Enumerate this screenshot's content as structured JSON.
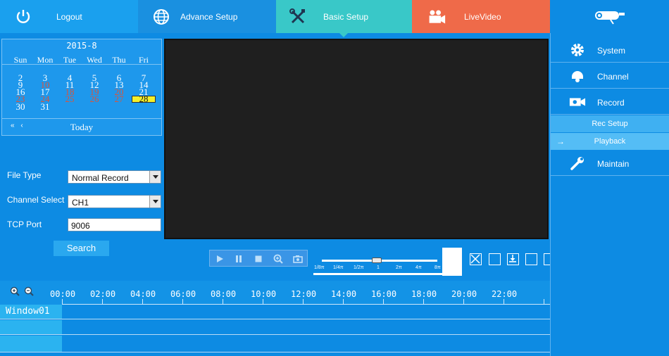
{
  "top_tabs": {
    "logout": "Logout",
    "advance": "Advance Setup",
    "basic": "Basic Setup",
    "live": "LiveVideo"
  },
  "calendar": {
    "title": "2015-8",
    "weekdays": [
      "Sun",
      "Mon",
      "Tue",
      "Wed",
      "Thu",
      "Fri"
    ],
    "days": {
      "d2": "2",
      "d3": "3",
      "d4": "4",
      "d5": "5",
      "d6": "6",
      "d7": "7",
      "d9": "9",
      "d10": "10",
      "d11": "11",
      "d12": "12",
      "d13": "13",
      "d14": "14",
      "d16": "16",
      "d17": "17",
      "d18": "18",
      "d19": "19",
      "d20": "20",
      "d21": "21",
      "d23": "23",
      "d24": "24",
      "d25": "25",
      "d26": "26",
      "d27": "27",
      "d28": "28",
      "d30": "30",
      "d31": "31"
    },
    "nav": "« ‹",
    "today": "Today"
  },
  "form": {
    "file_type_label": "File Type",
    "file_type_value": "Normal Record",
    "channel_label": "Channel Select",
    "channel_value": "CH1",
    "tcp_label": "TCP Port",
    "tcp_value": "9006",
    "search": "Search"
  },
  "speed": {
    "labels": [
      "1/8π",
      "1/4π",
      "1/2π",
      "1",
      "2π",
      "4π",
      "8π"
    ],
    "current": "1"
  },
  "timeline": {
    "hours": [
      "00:00",
      "02:00",
      "04:00",
      "06:00",
      "08:00",
      "10:00",
      "12:00",
      "14:00",
      "16:00",
      "18:00",
      "20:00",
      "22:00"
    ],
    "rows": [
      "Window01",
      "",
      ""
    ]
  },
  "right_nav": {
    "system": "System",
    "channel": "Channel",
    "record": "Record",
    "rec_setup": "Rec Setup",
    "playback": "Playback",
    "playback_arrow": "→",
    "maintain": "Maintain"
  }
}
